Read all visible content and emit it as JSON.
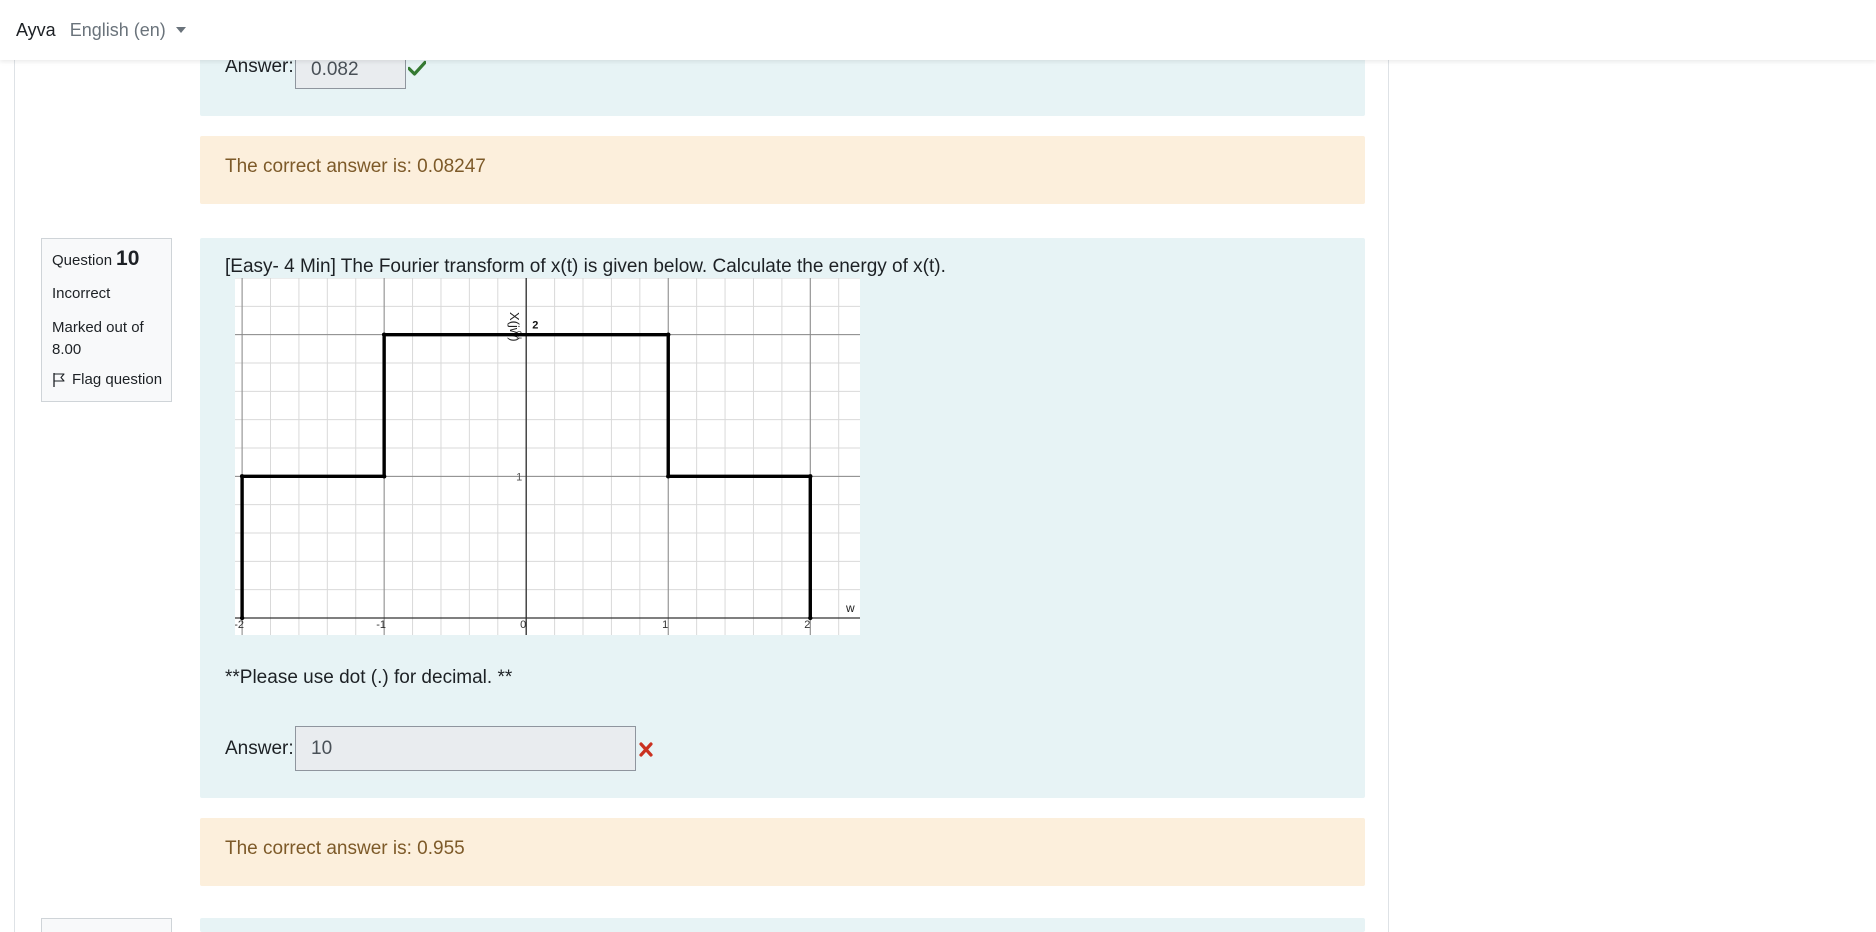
{
  "navbar": {
    "user_name": "Ayva",
    "language": "English (en)"
  },
  "previous_question": {
    "answer_label": "Answer:",
    "answer_value": "0.082",
    "result_icon": "check-icon",
    "correct_answer_text": "The correct answer is: 0.08247"
  },
  "question": {
    "number_word": "Question",
    "number": "10",
    "state": "Incorrect",
    "grade": "Marked out of 8.00",
    "flag_label": "Flag question",
    "text": "[Easy- 4 Min] The Fourier transform of x(t) is given below. Calculate the energy of x(t).",
    "note": "**Please use dot (.) for decimal. **",
    "answer_label": "Answer:",
    "answer_value": "10",
    "result_icon": "cross-icon",
    "correct_answer_text": "The correct answer is: 0.955"
  },
  "colors": {
    "formulation_bg": "#e7f3f5",
    "feedback_bg": "#fcefdc",
    "feedback_text": "#7d5a29",
    "correct_green": "#357a32",
    "incorrect_red": "#ca3120"
  },
  "chart_data": {
    "type": "line",
    "ylabel": "X(jw)",
    "xlabel": "w",
    "x_ticks": [
      "-2",
      "-1",
      "0",
      "1",
      "2"
    ],
    "y_ticks": [
      "1",
      "2"
    ],
    "peak_label": "2",
    "xlim": [
      -2.05,
      2.35
    ],
    "ylim": [
      -0.12,
      2.4
    ],
    "series": [
      {
        "x": [
          -2,
          -2,
          -1,
          -1,
          1,
          1,
          2,
          2
        ],
        "y": [
          0,
          1,
          1,
          2,
          2,
          1,
          1,
          0
        ]
      }
    ]
  }
}
